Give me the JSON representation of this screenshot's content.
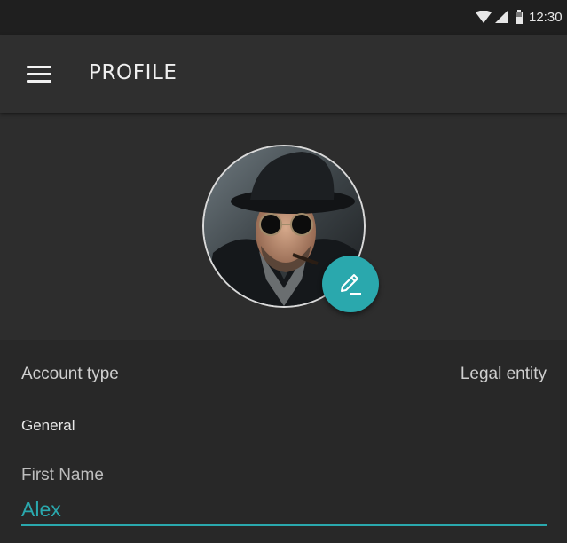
{
  "status_bar": {
    "time": "12:30",
    "icons": [
      "wifi-icon",
      "signal-icon",
      "battery-icon"
    ]
  },
  "app_bar": {
    "menu_icon": "menu-icon",
    "title": "PROFILE"
  },
  "profile": {
    "avatar": "avatar",
    "edit_icon": "edit-icon",
    "accent_color": "#2aa8ad"
  },
  "form": {
    "account_type": {
      "label": "Account type",
      "value": "Legal entity"
    },
    "section_general": "General",
    "first_name": {
      "label": "First Name",
      "value": "Alex"
    }
  }
}
